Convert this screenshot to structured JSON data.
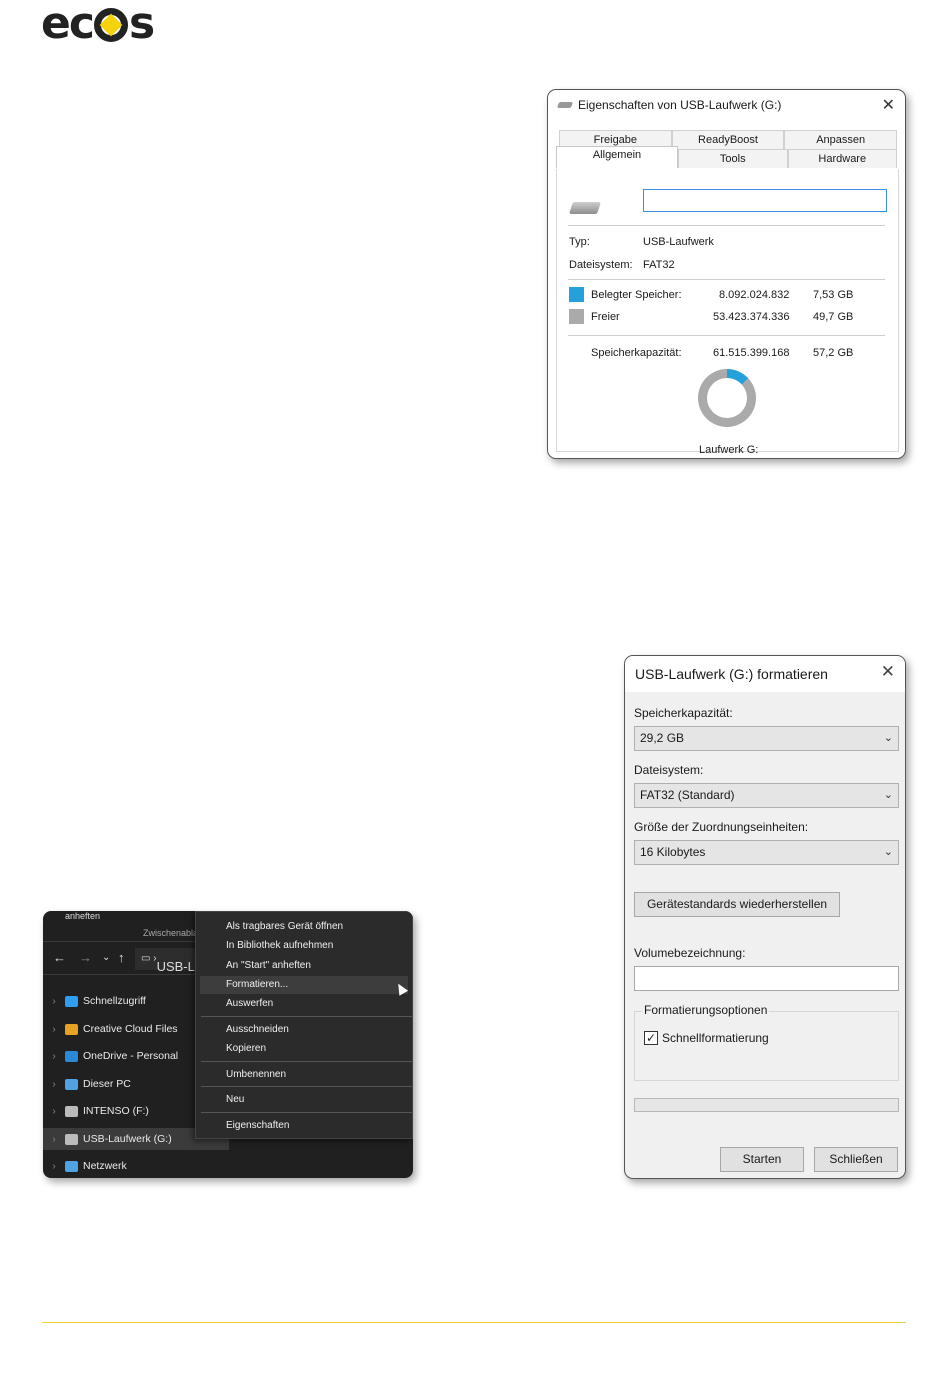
{
  "logo": {
    "part1": "ec",
    "part2": "s"
  },
  "props": {
    "title": "Eigenschaften von USB-Laufwerk (G:)",
    "tabs_row1": [
      "Freigabe",
      "ReadyBoost",
      "Anpassen"
    ],
    "tabs_row2": [
      "Allgemein",
      "Tools",
      "Hardware"
    ],
    "type_label": "Typ:",
    "type_value": "USB-Laufwerk",
    "fs_label": "Dateisystem:",
    "fs_value": "FAT32",
    "used_label": "Belegter Speicher:",
    "used_bytes": "8.092.024.832",
    "used_gb": "7,53 GB",
    "free_label": "Freier",
    "free_bytes": "53.423.374.336",
    "free_gb": "49,7 GB",
    "cap_label": "Speicherkapazität:",
    "cap_bytes": "61.515.399.168",
    "cap_gb": "57,2 GB",
    "drive_label": "Laufwerk G:",
    "used_fraction": 0.13,
    "colors": {
      "used": "#26a0da",
      "free": "#aaaaaa"
    }
  },
  "explorer": {
    "ribbon_pin": "anheften",
    "ribbon_clipboard": "Zwischenabla",
    "address": "USB-L",
    "tree": [
      {
        "label": "Schnellzugriff",
        "icon": "star-icon",
        "color": "#2f9ef0"
      },
      {
        "label": "Creative Cloud Files",
        "icon": "creative-cloud-icon",
        "color": "#e6a323"
      },
      {
        "label": "OneDrive - Personal",
        "icon": "onedrive-icon",
        "color": "#2a8ad8"
      },
      {
        "label": "Dieser PC",
        "icon": "pc-icon",
        "color": "#4fa3e0"
      },
      {
        "label": "INTENSO (F:)",
        "icon": "drive-icon",
        "color": "#bbbbbb"
      },
      {
        "label": "USB-Laufwerk (G:)",
        "icon": "drive-icon",
        "color": "#bbbbbb"
      },
      {
        "label": "Netzwerk",
        "icon": "network-icon",
        "color": "#4fa3e0"
      }
    ],
    "context_menu": [
      "Als tragbares Gerät öffnen",
      "In Bibliothek aufnehmen",
      "An \"Start\" anheften",
      "Formatieren...",
      "Auswerfen",
      "Ausschneiden",
      "Kopieren",
      "Umbenennen",
      "Neu",
      "Eigenschaften"
    ]
  },
  "format": {
    "title": "USB-Laufwerk (G:) formatieren",
    "capacity_label": "Speicherkapazität:",
    "capacity_value": "29,2 GB",
    "fs_label": "Dateisystem:",
    "fs_value": "FAT32 (Standard)",
    "alloc_label": "Größe der Zuordnungseinheiten:",
    "alloc_value": "16 Kilobytes",
    "restore_button": "Gerätestandards wiederherstellen",
    "volume_label": "Volumebezeichnung:",
    "options_label": "Formatierungsoptionen",
    "quick_format": "Schnellformatierung",
    "start_button": "Starten",
    "close_button": "Schließen"
  }
}
